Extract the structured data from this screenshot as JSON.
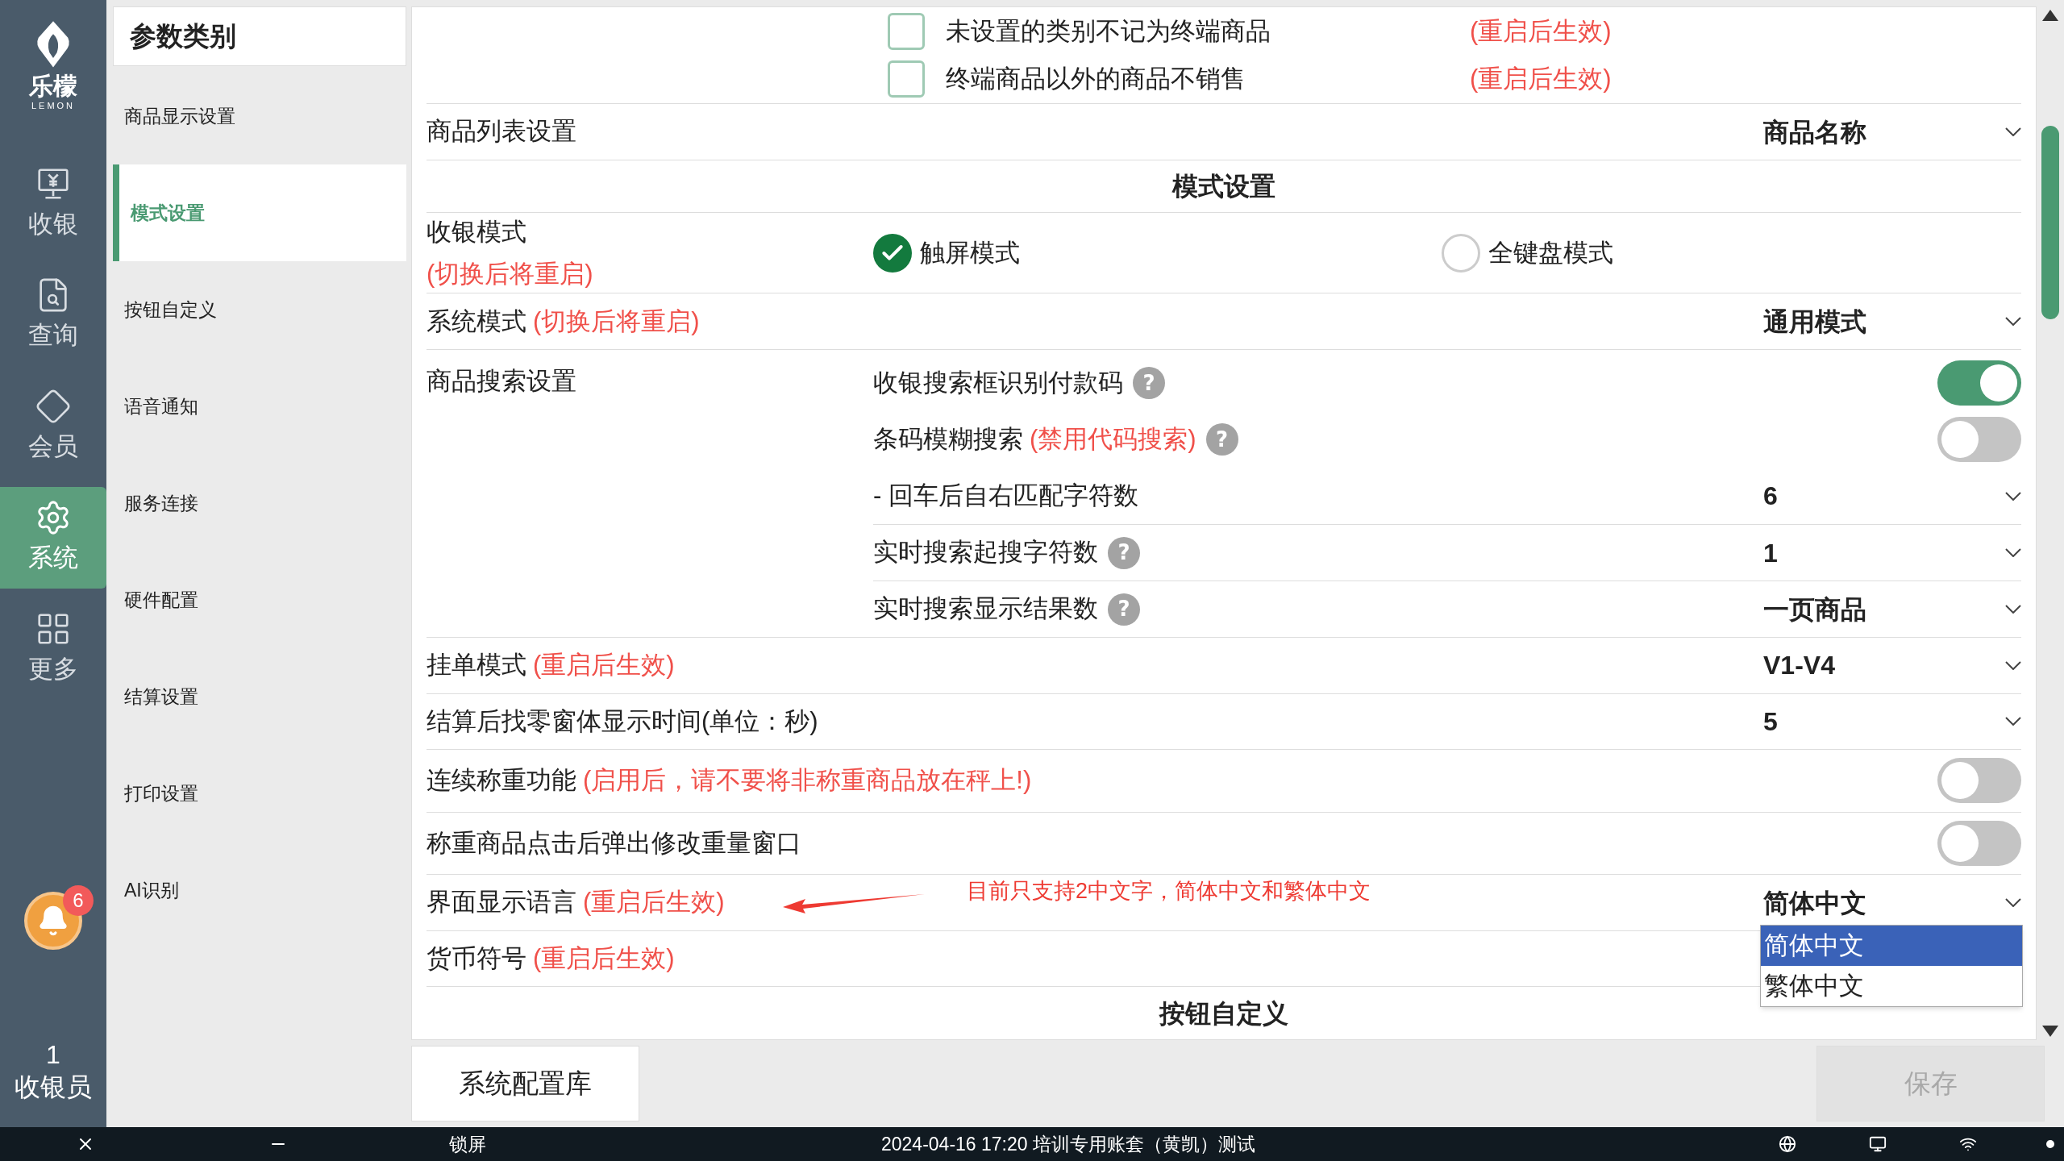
{
  "brand": {
    "name": "乐檬",
    "sub": "LEMON"
  },
  "nav": [
    {
      "label": "收银",
      "selected": false
    },
    {
      "label": "查询",
      "selected": false
    },
    {
      "label": "会员",
      "selected": false
    },
    {
      "label": "系统",
      "selected": true
    },
    {
      "label": "更多",
      "selected": false
    }
  ],
  "notification": {
    "count": "6"
  },
  "user": {
    "count": "1",
    "label": "收银员"
  },
  "categories": {
    "title": "参数类别",
    "items": [
      {
        "label": "商品显示设置",
        "selected": false
      },
      {
        "label": "模式设置",
        "selected": true
      },
      {
        "label": "按钮自定义",
        "selected": false
      },
      {
        "label": "语音通知",
        "selected": false
      },
      {
        "label": "服务连接",
        "selected": false
      },
      {
        "label": "硬件配置",
        "selected": false
      },
      {
        "label": "结算设置",
        "selected": false
      },
      {
        "label": "打印设置",
        "selected": false
      },
      {
        "label": "AI识别",
        "selected": false
      }
    ]
  },
  "settings": [
    {
      "kind": "checkbox",
      "label": "未设置的类别不记为终端商品",
      "note": "(重启后生效)",
      "checked": false
    },
    {
      "kind": "checkbox",
      "label": "终端商品以外的商品不销售",
      "note": "(重启后生效)",
      "checked": false
    },
    {
      "kind": "select",
      "label": "商品列表设置",
      "value": "商品名称"
    },
    {
      "kind": "header",
      "label": "模式设置"
    },
    {
      "kind": "radio",
      "label": "收银模式",
      "note": "(切换后将重启)",
      "options": [
        {
          "label": "触屏模式",
          "selected": true
        },
        {
          "label": "全键盘模式",
          "selected": false
        }
      ]
    },
    {
      "kind": "select",
      "label": "系统模式",
      "note": "(切换后将重启)",
      "value": "通用模式"
    },
    {
      "kind": "group",
      "label": "商品搜索设置",
      "items": [
        {
          "kind": "toggle",
          "label": "收银搜索框识别付款码",
          "help": "?",
          "on": true
        },
        {
          "kind": "toggle",
          "label": "条码模糊搜索",
          "note": "(禁用代码搜索)",
          "help": "?",
          "on": false
        },
        {
          "kind": "select",
          "label": "- 回车后自右匹配字符数",
          "value": "6"
        },
        {
          "kind": "select",
          "label": "实时搜索起搜字符数",
          "help": "?",
          "value": "1"
        },
        {
          "kind": "select",
          "label": "实时搜索显示结果数",
          "help": "?",
          "value": "一页商品"
        }
      ]
    },
    {
      "kind": "select",
      "label": "挂单模式",
      "note": "(重启后生效)",
      "value": "V1-V4"
    },
    {
      "kind": "select",
      "label": "结算后找零窗体显示时间(单位：秒)",
      "value": "5"
    },
    {
      "kind": "toggle",
      "label": "连续称重功能",
      "note": "(启用后，请不要将非称重商品放在秤上!)",
      "on": false
    },
    {
      "kind": "toggle",
      "label": "称重商品点击后弹出修改重量窗口",
      "on": false
    },
    {
      "kind": "select",
      "label": "界面显示语言",
      "note": "(重启后生效)",
      "value": "简体中文",
      "annotation": "目前只支持2中文字，简体中文和繁体中文",
      "options": [
        {
          "label": "简体中文",
          "selected": true
        },
        {
          "label": "繁体中文",
          "selected": false
        }
      ]
    },
    {
      "kind": "select",
      "label": "货币符号",
      "note": "(重启后生效)"
    },
    {
      "kind": "header",
      "label": "按钮自定义"
    }
  ],
  "footer": {
    "config_button": "系统配置库",
    "save_button": {
      "label": "保存",
      "disabled": true
    }
  },
  "taskbar": {
    "lock": "锁屏",
    "status": "2024-04-16 17:20 培训专用账套（黄凯）测试"
  }
}
